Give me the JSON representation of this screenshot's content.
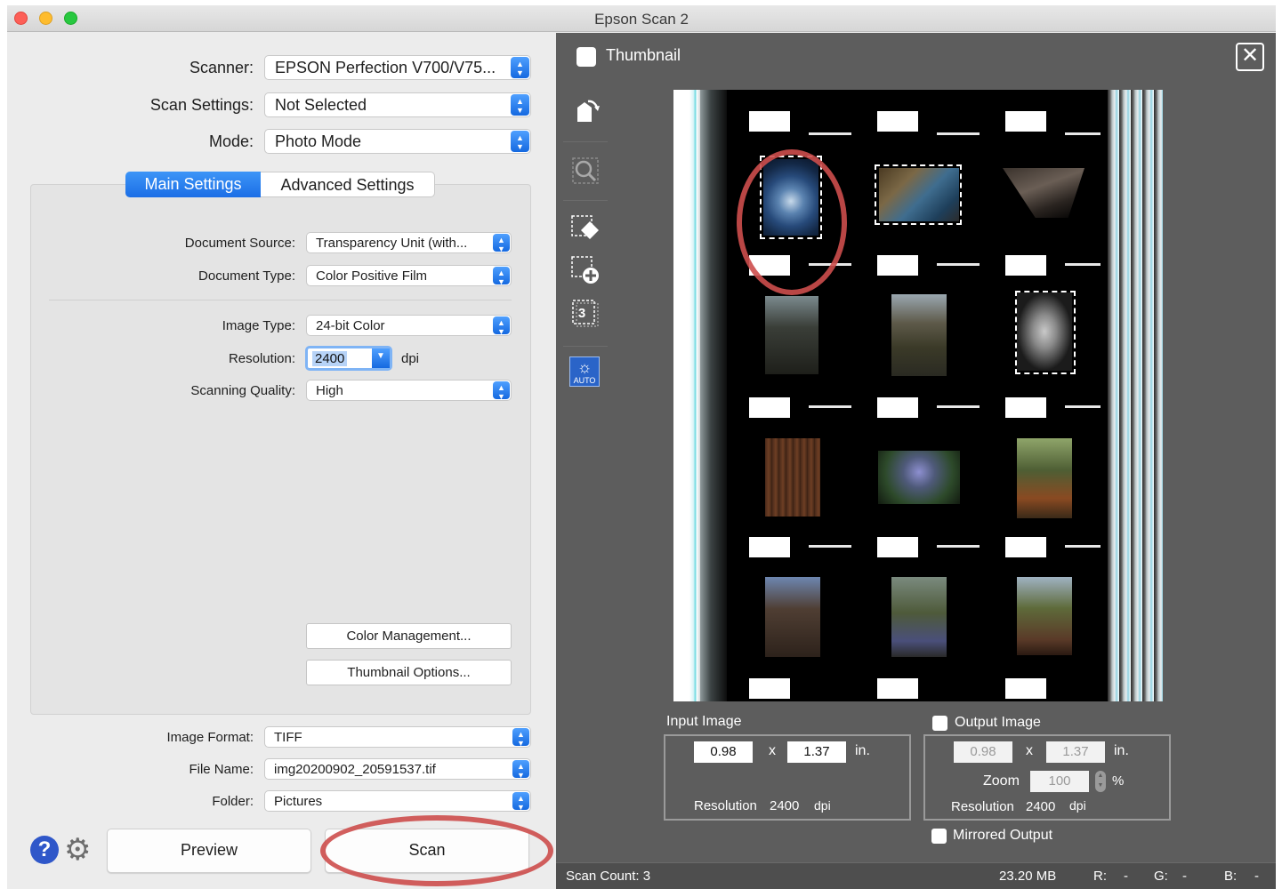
{
  "window": {
    "title": "Epson Scan 2"
  },
  "top": {
    "scanner_label": "Scanner:",
    "scanner_value": "EPSON Perfection V700/V75...",
    "scan_settings_label": "Scan Settings:",
    "scan_settings_value": "Not Selected",
    "mode_label": "Mode:",
    "mode_value": "Photo Mode"
  },
  "tabs": {
    "main": "Main Settings",
    "advanced": "Advanced Settings"
  },
  "main_settings": {
    "document_source_label": "Document Source:",
    "document_source_value": "Transparency Unit (with...",
    "document_type_label": "Document Type:",
    "document_type_value": "Color Positive Film",
    "image_type_label": "Image Type:",
    "image_type_value": "24-bit Color",
    "resolution_label": "Resolution:",
    "resolution_value": "2400",
    "resolution_unit": "dpi",
    "scanning_quality_label": "Scanning Quality:",
    "scanning_quality_value": "High",
    "color_management_button": "Color Management...",
    "thumbnail_options_button": "Thumbnail Options..."
  },
  "output": {
    "image_format_label": "Image Format:",
    "image_format_value": "TIFF",
    "file_name_label": "File Name:",
    "file_name_value": "img20200902_20591537.tif",
    "folder_label": "Folder:",
    "folder_value": "Pictures"
  },
  "actions": {
    "help_glyph": "?",
    "gear_glyph": "⚙",
    "preview": "Preview",
    "scan": "Scan"
  },
  "thumbnail_panel": {
    "thumbnail_label": "Thumbnail",
    "close_glyph": "✕",
    "tools": [
      "rotate-icon",
      "zoom-icon",
      "eraser-marquee-icon",
      "add-marquee-icon",
      "marquee-count-icon",
      "auto-exposure-icon"
    ],
    "marquee_count": "3",
    "auto_label": "AUTO",
    "auto_glyph": "☼"
  },
  "input_image": {
    "label": "Input Image",
    "width": "0.98",
    "x": "x",
    "height": "1.37",
    "unit": "in.",
    "resolution_label": "Resolution",
    "resolution_value": "2400",
    "resolution_unit": "dpi"
  },
  "output_image": {
    "label": "Output Image",
    "width": "0.98",
    "x": "x",
    "height": "1.37",
    "unit": "in.",
    "zoom_label": "Zoom",
    "zoom_value": "100",
    "zoom_unit": "%",
    "resolution_label": "Resolution",
    "resolution_value": "2400",
    "resolution_unit": "dpi",
    "mirrored_label": "Mirrored Output"
  },
  "status": {
    "scan_count": "Scan Count: 3",
    "size": "23.20 MB",
    "r_label": "R:",
    "r_value": "-",
    "g_label": "G:",
    "g_value": "-",
    "b_label": "B:",
    "b_value": "-"
  },
  "colors": {
    "accent": "#1b6ee6",
    "panel_dark": "#5d5d5d",
    "annotation": "#cd4e4c"
  }
}
